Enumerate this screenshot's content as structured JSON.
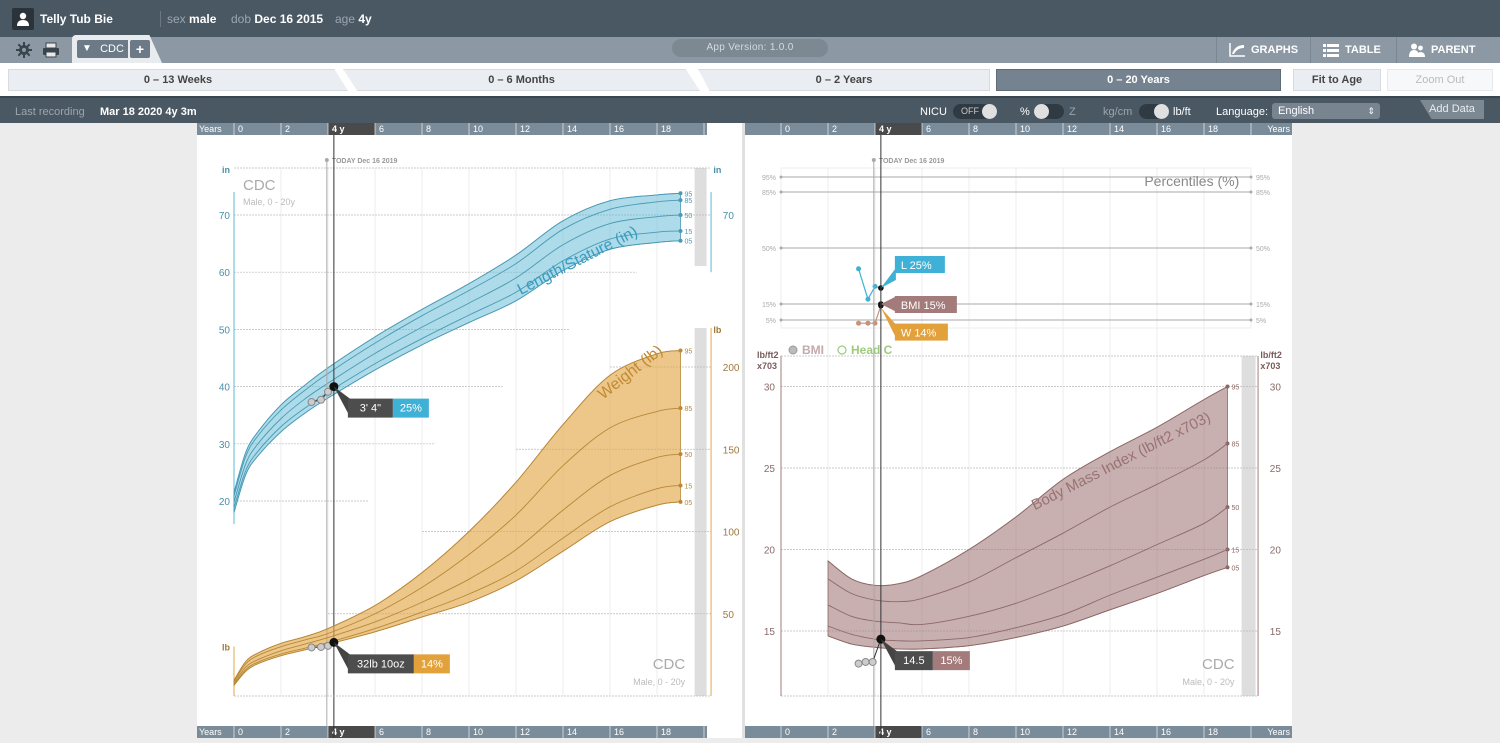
{
  "patient": {
    "name": "Telly Tub Bie",
    "sex_label": "sex",
    "sex": "male",
    "dob_label": "dob",
    "dob": "Dec 16 2015",
    "age_label": "age",
    "age": "4y"
  },
  "toolbar": {
    "settings_icon": "gear-icon",
    "print_icon": "printer-icon",
    "chart_tab": "CDC",
    "add_tab": "+",
    "app_version": "App Version: 1.0.0"
  },
  "nav": [
    {
      "label": "GRAPHS",
      "icon": "graph-icon"
    },
    {
      "label": "TABLE",
      "icon": "list-icon"
    },
    {
      "label": "PARENT",
      "icon": "people-icon"
    }
  ],
  "ranges": [
    {
      "label": "0 – 13 Weeks",
      "selected": false
    },
    {
      "label": "0 – 6 Months",
      "selected": false
    },
    {
      "label": "0 – 2 Years",
      "selected": false
    },
    {
      "label": "0 – 20 Years",
      "selected": true
    }
  ],
  "fit_to_age": "Fit to Age",
  "zoom_out": "Zoom Out",
  "status": {
    "last_recording_label": "Last recording",
    "last_recording": "Mar 18 2020  4y 3m",
    "nicu_label": "NICU",
    "nicu_state": "OFF",
    "pct_label": "%",
    "z_label": "Z",
    "kgcm_label": "kg/cm",
    "lbft_label": "lb/ft",
    "language_label": "Language:",
    "language": "English",
    "add_data": "Add Data"
  },
  "colors": {
    "length": "#5bb8d4",
    "weight": "#e2a94a",
    "bmi": "#a47b7b",
    "headc": "#9ccb7c",
    "header": "#4a5864"
  },
  "chart_data": [
    {
      "type": "line",
      "title": "Length/Stature (in)",
      "source": "CDC",
      "subtitle": "Male, 0 - 20y",
      "xlabel": "Years",
      "x_ticks": [
        "0",
        "2",
        "4 y",
        "6",
        "8",
        "10",
        "12",
        "14",
        "16",
        "18"
      ],
      "xlim": [
        0,
        20
      ],
      "ylabel": "in",
      "y_ticks": [
        20,
        30,
        40,
        50,
        60,
        70
      ],
      "ylim": [
        15,
        75
      ],
      "today_label": "TODAY Dec 16 2019",
      "current_age": 4.25,
      "x": [
        0,
        0.5,
        1,
        2,
        3,
        4,
        6,
        8,
        10,
        12,
        14,
        16,
        18,
        19
      ],
      "series": [
        {
          "name": "95",
          "values": [
            21.5,
            28.5,
            32.0,
            36.8,
            40.2,
            43.3,
            48.7,
            53.5,
            58.0,
            63.0,
            69.0,
            72.5,
            73.5,
            73.8
          ]
        },
        {
          "name": "85",
          "values": [
            20.9,
            27.8,
            31.3,
            35.9,
            39.3,
            42.3,
            47.6,
            52.4,
            56.8,
            61.5,
            67.5,
            71.0,
            72.3,
            72.6
          ]
        },
        {
          "name": "50",
          "values": [
            19.8,
            26.5,
            29.9,
            34.4,
            37.8,
            40.6,
            45.8,
            50.4,
            54.6,
            59.0,
            64.8,
            68.5,
            69.7,
            70.0
          ]
        },
        {
          "name": "15",
          "values": [
            18.8,
            25.3,
            28.6,
            33.0,
            36.2,
            39.0,
            44.0,
            48.4,
            52.5,
            56.5,
            62.0,
            65.8,
            67.0,
            67.2
          ]
        },
        {
          "name": "05",
          "values": [
            18.0,
            24.6,
            27.8,
            32.1,
            35.3,
            38.0,
            42.9,
            47.3,
            51.2,
            55.0,
            60.3,
            64.0,
            65.2,
            65.5
          ]
        }
      ],
      "measurements": {
        "x": [
          3.3,
          3.7,
          4.0,
          4.25
        ],
        "values": [
          37.3,
          37.7,
          39.1,
          40.0
        ]
      },
      "callout": {
        "value": "3' 4\"",
        "percentile": "25%"
      }
    },
    {
      "type": "line",
      "title": "Weight (lb)",
      "source": "CDC",
      "subtitle": "Male, 0 - 20y",
      "xlabel": "Years",
      "xlim": [
        0,
        20
      ],
      "ylabel": "lb",
      "y_ticks": [
        50,
        100,
        150,
        200
      ],
      "ylim": [
        0,
        225
      ],
      "x": [
        0,
        0.5,
        1,
        2,
        3,
        4,
        6,
        8,
        10,
        12,
        14,
        16,
        18,
        19
      ],
      "series": [
        {
          "name": "95",
          "values": [
            9.5,
            21,
            26,
            32,
            36,
            41,
            55,
            75,
            100,
            130,
            165,
            195,
            208,
            210
          ]
        },
        {
          "name": "85",
          "values": [
            8.8,
            19.5,
            24.5,
            30,
            34,
            38,
            50,
            66,
            86,
            110,
            140,
            163,
            173,
            175
          ]
        },
        {
          "name": "50",
          "values": [
            7.8,
            17.5,
            22,
            27.5,
            31.5,
            35.5,
            45,
            57,
            71,
            89,
            113,
            134,
            145,
            147
          ]
        },
        {
          "name": "15",
          "values": [
            7.0,
            16,
            20.5,
            25.5,
            29,
            32.5,
            41,
            51,
            62,
            76,
            96,
            115,
            126,
            128
          ]
        },
        {
          "name": "05",
          "values": [
            6.5,
            15,
            19.5,
            24.5,
            28,
            31.5,
            39,
            48,
            57,
            70,
            88,
            106,
            116,
            118
          ]
        }
      ],
      "measurements": {
        "x": [
          3.3,
          3.7,
          4.0,
          4.25
        ],
        "values": [
          29.5,
          29.8,
          30.5,
          32.6
        ]
      },
      "callout": {
        "value": "32lb 10oz",
        "percentile": "14%"
      }
    },
    {
      "type": "line",
      "title": "Percentiles (%)",
      "xlim": [
        0,
        20
      ],
      "y_ticks": [
        "95%",
        "85%",
        "50%",
        "15%",
        "5%"
      ],
      "lines": [
        {
          "name": "L",
          "x": [
            3.3,
            3.7,
            4.0,
            4.25
          ],
          "values": [
            37,
            18,
            26,
            25
          ],
          "label": "L  25%"
        },
        {
          "name": "BMI",
          "x": [
            4.25
          ],
          "values": [
            15
          ],
          "label": "BMI  15%"
        },
        {
          "name": "W",
          "x": [
            3.3,
            3.7,
            4.0,
            4.25
          ],
          "values": [
            3,
            3,
            3,
            14
          ],
          "label": "W  14%"
        }
      ]
    },
    {
      "type": "line",
      "title": "Body Mass Index (lb/ft2 x703)",
      "source": "CDC",
      "subtitle": "Male, 0 - 20y",
      "legend": [
        "BMI",
        "Head C"
      ],
      "xlabel": "Years",
      "xlim": [
        0,
        20
      ],
      "ylabel": "lb/ft2 x703",
      "y_ticks": [
        15,
        20,
        25,
        30
      ],
      "ylim": [
        11,
        31.5
      ],
      "x": [
        2,
        3,
        4,
        5,
        6,
        8,
        10,
        12,
        14,
        16,
        18,
        19
      ],
      "series": [
        {
          "name": "95",
          "values": [
            19.3,
            18.2,
            17.8,
            17.9,
            18.4,
            20.0,
            22.0,
            24.3,
            26.0,
            27.5,
            29.2,
            30.0
          ]
        },
        {
          "name": "85",
          "values": [
            18.2,
            17.3,
            16.9,
            16.8,
            17.0,
            18.0,
            19.5,
            21.0,
            22.6,
            24.0,
            25.5,
            26.5
          ]
        },
        {
          "name": "50",
          "values": [
            16.6,
            15.9,
            15.6,
            15.5,
            15.4,
            15.9,
            16.7,
            17.8,
            19.0,
            20.3,
            21.6,
            22.6
          ]
        },
        {
          "name": "15",
          "values": [
            15.3,
            14.8,
            14.5,
            14.4,
            14.4,
            14.6,
            15.2,
            16.0,
            17.2,
            18.3,
            19.4,
            20.0
          ]
        },
        {
          "name": "05",
          "values": [
            14.7,
            14.2,
            14.0,
            13.9,
            13.9,
            14.1,
            14.6,
            15.3,
            16.3,
            17.3,
            18.4,
            18.9
          ]
        }
      ],
      "measurements": {
        "x": [
          3.3,
          3.6,
          3.9,
          4.25
        ],
        "values": [
          13.0,
          13.1,
          13.1,
          14.5
        ]
      },
      "callout": {
        "value": "14.5",
        "percentile": "15%"
      }
    }
  ]
}
